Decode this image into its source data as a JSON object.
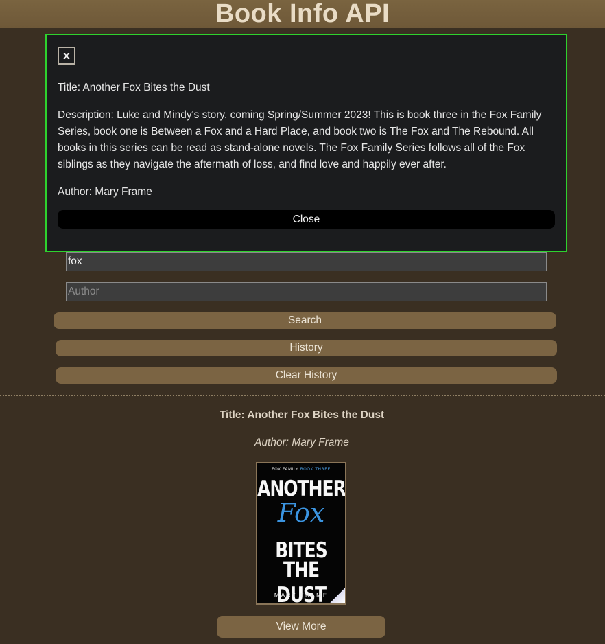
{
  "header": {
    "title": "Book Info API"
  },
  "modal": {
    "close_x": "x",
    "title_line": "Title: Another Fox Bites the Dust",
    "description_line": "Description: Luke and Mindy's story, coming Spring/Summer 2023! This is book three in the Fox Family Series, book one is Between a Fox and a Hard Place, and book two is The Fox and The Rebound. All books in this series can be read as stand-alone novels. The Fox Family Series follows all of the Fox siblings as they navigate the aftermath of loss, and find love and happily ever after.",
    "author_line": "Author: Mary Frame",
    "close_label": "Close",
    "border_color": "#2ed12e"
  },
  "search": {
    "title_value": "fox",
    "author_value": "",
    "author_placeholder": "Author",
    "search_label": "Search",
    "history_label": "History",
    "clear_history_label": "Clear History"
  },
  "result": {
    "title": "Title: Another Fox Bites the Dust",
    "author": "Author: Mary Frame",
    "cover": {
      "series_text": "FOX FAMILY",
      "book_number_text": "BOOK THREE",
      "line1": "ANOTHER",
      "line2": "Fox",
      "line3": "BITES",
      "line4": "THE DUST",
      "author": "MARY FRAME"
    },
    "view_more_label": "View More"
  },
  "colors": {
    "background": "#3a2f22",
    "header": "#7a6440",
    "button": "#7b6443",
    "modal_bg": "#1b1c1e"
  }
}
